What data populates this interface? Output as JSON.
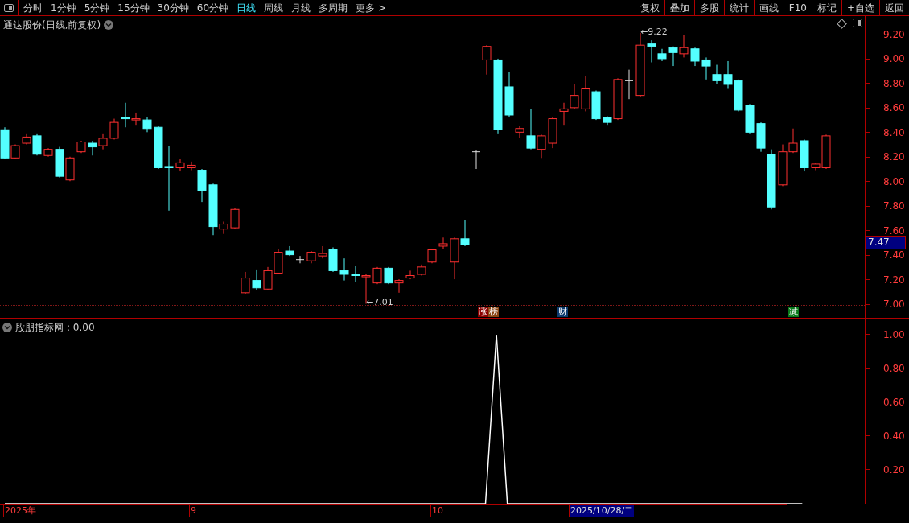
{
  "toolbar": {
    "periods": [
      {
        "label": "分时",
        "selected": false
      },
      {
        "label": "1分钟",
        "selected": false
      },
      {
        "label": "5分钟",
        "selected": false
      },
      {
        "label": "15分钟",
        "selected": false
      },
      {
        "label": "30分钟",
        "selected": false
      },
      {
        "label": "60分钟",
        "selected": false
      },
      {
        "label": "日线",
        "selected": true
      },
      {
        "label": "周线",
        "selected": false
      },
      {
        "label": "月线",
        "selected": false
      },
      {
        "label": "多周期",
        "selected": false
      },
      {
        "label": "更多 >",
        "selected": false
      }
    ],
    "buttons": [
      "复权",
      "叠加",
      "多股",
      "统计",
      "画线",
      "F10",
      "标记",
      "+自选",
      "返回"
    ]
  },
  "main_chart": {
    "title": "通达股份(日线,前复权)",
    "price_ticks": [
      "9.20",
      "9.00",
      "8.80",
      "8.60",
      "8.40",
      "8.20",
      "8.00",
      "7.80",
      "7.60",
      "7.40",
      "7.20",
      "7.00"
    ],
    "current_price": "7.47",
    "annotations": [
      {
        "kind": "low",
        "text": "←7.01"
      },
      {
        "kind": "high",
        "text": "←9.22"
      }
    ],
    "markers": [
      {
        "text": "涨",
        "color": "#8b0000"
      },
      {
        "text": "榜",
        "color": "#8b4513"
      },
      {
        "text": "财",
        "color": "#0b3a6e"
      },
      {
        "text": "减",
        "color": "#0a7a1a"
      }
    ]
  },
  "indicator": {
    "name": "股朋指标网",
    "reading": ": 0.00",
    "ticks": [
      "1.00",
      "0.80",
      "0.60",
      "0.40",
      "0.20"
    ]
  },
  "date_axis": [
    {
      "text": "2025年",
      "selected": false
    },
    {
      "text": "9",
      "selected": false
    },
    {
      "text": "10",
      "selected": false
    },
    {
      "text": "2025/10/28/二",
      "selected": true
    }
  ]
}
